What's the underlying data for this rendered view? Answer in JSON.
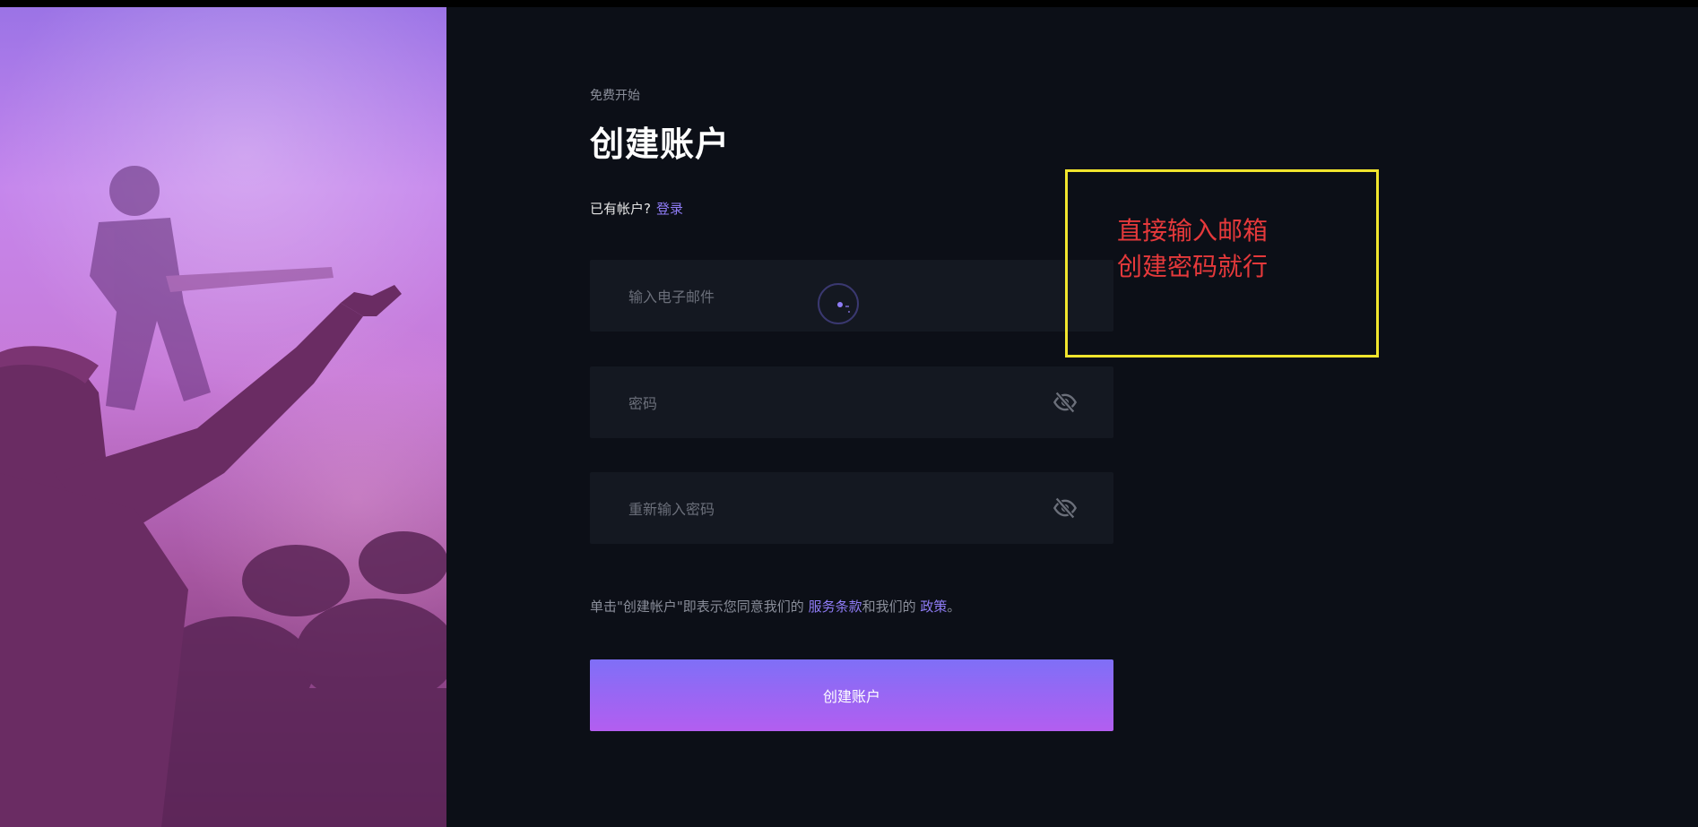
{
  "form": {
    "eyebrow": "免费开始",
    "title": "创建账户",
    "have_account_text": "已有帐户?",
    "login_link": "登录",
    "email_placeholder": "输入电子邮件",
    "password_placeholder": "密码",
    "confirm_password_placeholder": "重新输入密码",
    "terms_prefix": "单击\"创建帐户\"即表示您同意我们的 ",
    "terms_link": "服务条款",
    "terms_middle": "和我们的 ",
    "policy_link": "政策",
    "terms_suffix": "。",
    "submit_label": "创建账户"
  },
  "annotation": {
    "line1": "直接输入邮箱",
    "line2": "创建密码就行",
    "box_color": "#f1e52d",
    "text_color": "#e5393b"
  },
  "icons": {
    "password_toggle": "eye-slash-icon",
    "loading": "loading-spinner-icon"
  },
  "colors": {
    "background": "#0c0f17",
    "field": "#141821",
    "accent": "#8f7cf6",
    "button_top": "#7f6ff7",
    "button_bottom": "#b35ef0"
  }
}
